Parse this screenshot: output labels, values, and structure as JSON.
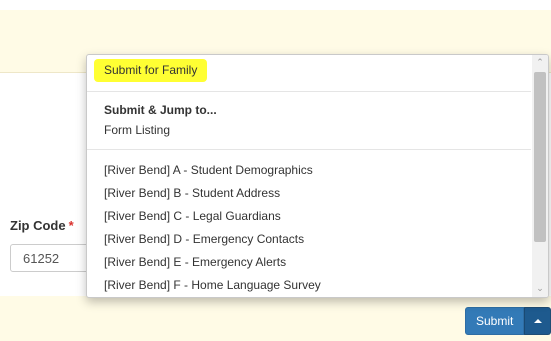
{
  "form": {
    "zip_label": "Zip Code",
    "required_mark": "*",
    "zip_value": "61252"
  },
  "submit": {
    "label": "Submit",
    "caret_icon": "caret-up-icon"
  },
  "dropdown": {
    "submit_family": "Submit for Family",
    "jump_header": "Submit & Jump to...",
    "form_listing": "Form Listing",
    "forms": [
      "[River Bend] A - Student Demographics",
      "[River Bend] B - Student Address",
      "[River Bend] C - Legal Guardians",
      "[River Bend] D - Emergency Contacts",
      "[River Bend] E - Emergency Alerts",
      "[River Bend] F - Home Language Survey"
    ],
    "scroll_up_icon": "chevron-up-icon",
    "scroll_down_icon": "chevron-down-icon"
  },
  "colors": {
    "panel_bg": "#fffbe6",
    "highlight": "#ffff33",
    "primary": "#337ab7",
    "required": "#d9302c"
  }
}
